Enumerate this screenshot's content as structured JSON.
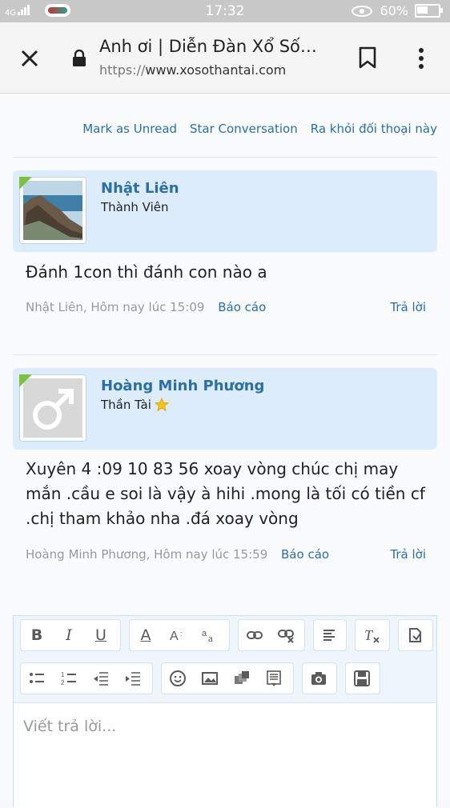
{
  "status_bar": {
    "signal_text": "4G",
    "time": "17:32",
    "battery": "60%",
    "battery_level": 0.6
  },
  "browser": {
    "title": "Anh ơi | Diễn Đàn Xổ Số…",
    "url_protocol": "https://",
    "url_host": "www.xosothantai.com"
  },
  "conversation_actions": [
    "Mark as Unread",
    "Star Conversation",
    "Ra khỏi đối thoại này"
  ],
  "messages": [
    {
      "username": "Nhật Liên",
      "user_title": "Thành Viên",
      "text": "Đánh 1con thì đánh con nào a",
      "meta": "Nhật Liên, Hôm nay lúc 15:09",
      "report": "Báo cáo",
      "reply": "Trả lời"
    },
    {
      "username": "Hoàng Minh Phương",
      "user_title": "Thần Tài",
      "text": "Xuyên 4 :09 10 83 56 xoay vòng chúc chị may mắn .cầu e soi là vậy à hihi .mong là tối có tiền cf .chị tham khảo nha .đá xoay vòng",
      "meta": "Hoàng Minh Phương, Hôm nay lúc 15:59",
      "report": "Báo cáo",
      "reply": "Trả lời"
    }
  ],
  "editor": {
    "placeholder": "Viết trả lời..."
  },
  "colors": {
    "link": "#2b6fa3",
    "header_bg": "#dcecfa",
    "online_badge": "#7bc043"
  }
}
